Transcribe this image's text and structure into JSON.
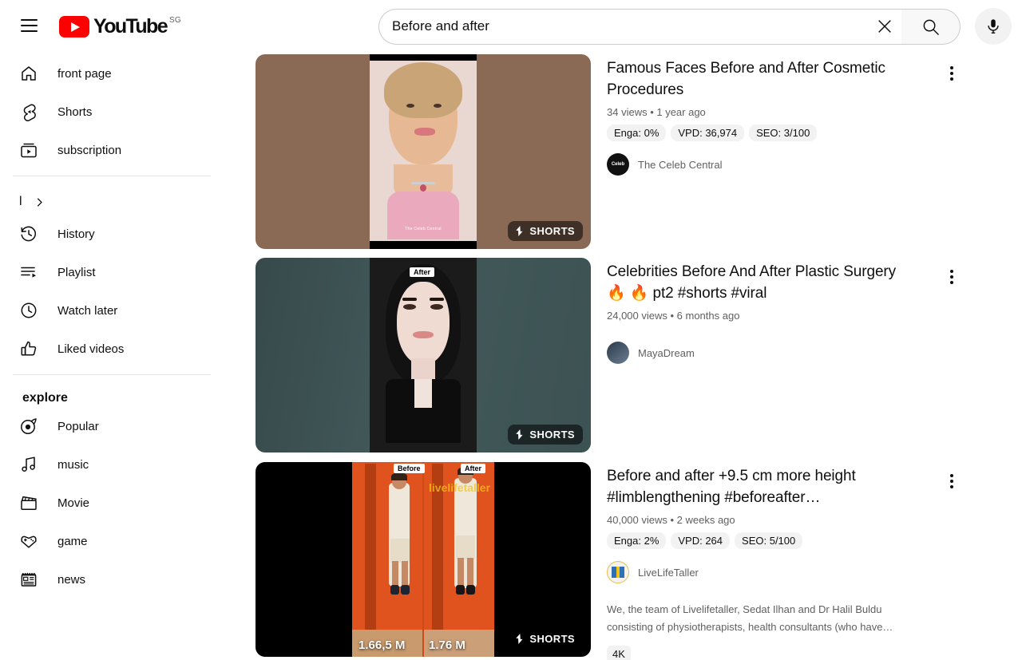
{
  "masthead": {
    "menu_icon": "hamburger-icon",
    "logo_text": "YouTube",
    "logo_country": "SG",
    "search_value": "Before and after",
    "search_placeholder": "Search",
    "clear_icon": "close-icon",
    "search_icon": "search-icon",
    "mic_icon": "microphone-icon"
  },
  "sidebar": {
    "primary": [
      {
        "label": "front page",
        "icon": "home-icon"
      },
      {
        "label": "Shorts",
        "icon": "shorts-icon"
      },
      {
        "label": "subscription",
        "icon": "subscriptions-icon"
      }
    ],
    "you_row": {
      "label": "l",
      "icon": "chevron-right-icon"
    },
    "library": [
      {
        "label": "History",
        "icon": "history-icon"
      },
      {
        "label": "Playlist",
        "icon": "playlist-icon"
      },
      {
        "label": "Watch later",
        "icon": "clock-icon"
      },
      {
        "label": "Liked videos",
        "icon": "thumbs-up-icon"
      }
    ],
    "explore_title": "explore",
    "explore": [
      {
        "label": "Popular",
        "icon": "trending-icon"
      },
      {
        "label": "music",
        "icon": "music-icon"
      },
      {
        "label": "Movie",
        "icon": "film-icon"
      },
      {
        "label": "game",
        "icon": "gamepad-icon"
      },
      {
        "label": "news",
        "icon": "news-icon"
      }
    ]
  },
  "results": [
    {
      "title": "Famous Faces Before and After Cosmetic Procedures",
      "meta": "34 views • 1 year ago",
      "chips": [
        "Enga: 0%",
        "VPD: 36,974",
        "SEO: 3/100"
      ],
      "channel": "The Celeb Central",
      "avatar_text": "Celeb",
      "badge": "SHORTS",
      "description": "",
      "quality": "",
      "thumb_bg": "#8b6a55",
      "thumb_accent": "#e9d8d1",
      "overlay_label": "",
      "watermark": "The Celeb Central"
    },
    {
      "title": "Celebrities Before And After Plastic Surgery 🔥 🔥 pt2 #shorts #viral",
      "meta": "24,000 views • 6 months ago",
      "chips": [],
      "channel": "MayaDream",
      "avatar_text": "",
      "badge": "SHORTS",
      "description": "",
      "quality": "",
      "thumb_bg": "#3e5455",
      "thumb_accent": "#1b1b1b",
      "overlay_label": "After",
      "watermark": ""
    },
    {
      "title": "Before and after +9.5 cm more height #limblengthening #beforeafter…",
      "meta": "40,000 views • 2 weeks ago",
      "chips": [
        "Enga: 2%",
        "VPD: 264",
        "SEO: 5/100"
      ],
      "channel": "LiveLifeTaller",
      "avatar_text": "",
      "badge": "SHORTS",
      "description": "We, the team of Livelifetaller, Sedat Ilhan and Dr Halil Buldu consisting of physiotherapists, health consultants (who have…",
      "quality": "4K",
      "thumb_bg": "#000000",
      "thumb_accent": "#e0531e",
      "overlay_label_before": "Before",
      "overlay_label_after": "After",
      "height_before": "1.66,5 M",
      "height_after": "1.76 M",
      "watermark": "livelifetaller"
    }
  ],
  "colors": {
    "brand_red": "#ff0000",
    "text_primary": "#0f0f0f",
    "text_secondary": "#606060",
    "chip_bg": "#f2f2f2"
  }
}
